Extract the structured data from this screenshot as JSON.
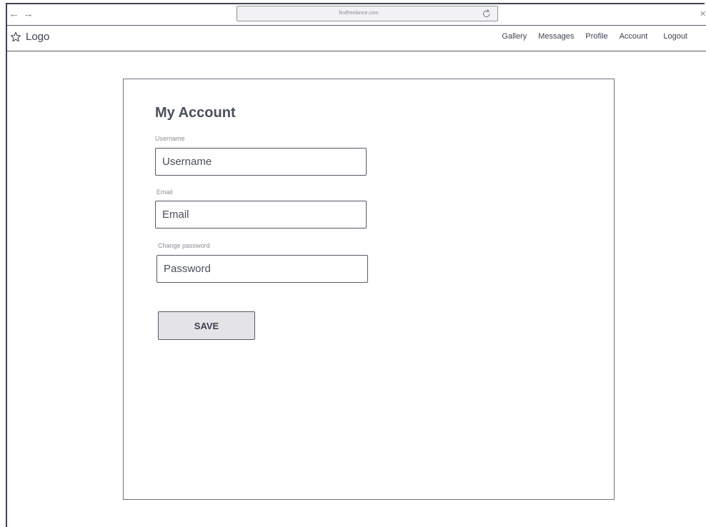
{
  "browser": {
    "back_icon": "←",
    "forward_icon": "→",
    "url": "findfreelance.com",
    "close_icon": "×"
  },
  "header": {
    "logo_text": "Logo",
    "logo_icon": "star-outline-icon"
  },
  "nav": {
    "items": [
      {
        "label": "Gallery"
      },
      {
        "label": "Messages"
      },
      {
        "label": "Profile"
      },
      {
        "label": "Account"
      },
      {
        "label": "Logout"
      }
    ]
  },
  "account_form": {
    "title": "My Account",
    "username": {
      "label": "Username",
      "placeholder": "Username",
      "value": ""
    },
    "email": {
      "label": "Email",
      "placeholder": "Email",
      "value": ""
    },
    "password": {
      "label": "Change password",
      "placeholder": "Password",
      "value": ""
    },
    "save_label": "SAVE"
  },
  "colors": {
    "border": "#3e4250",
    "text": "#4a4f5c",
    "label": "#8a8d95",
    "button_bg": "#e4e4e6"
  }
}
